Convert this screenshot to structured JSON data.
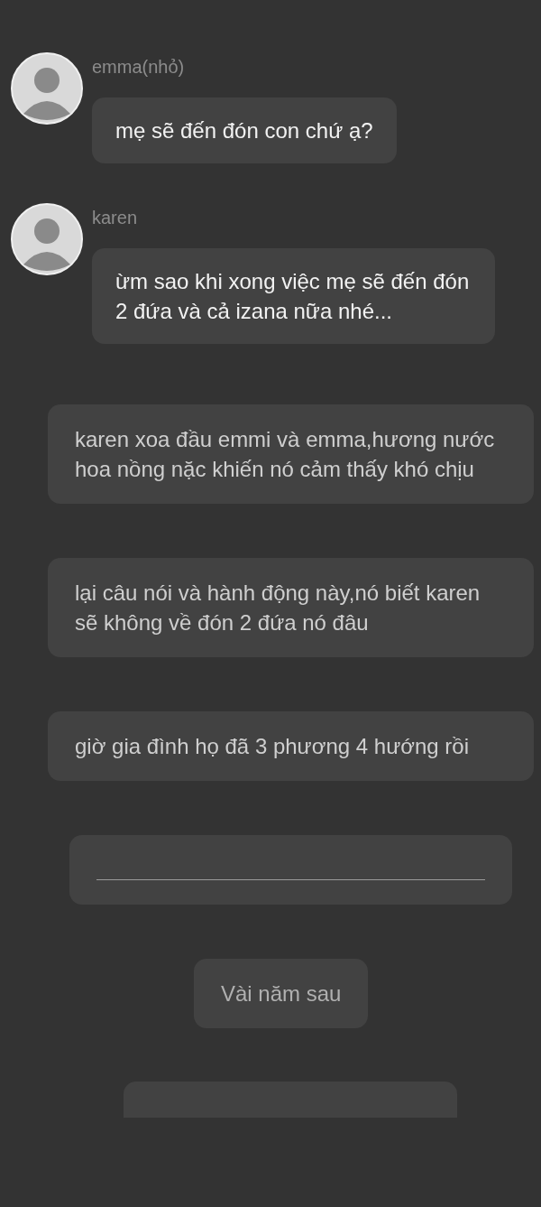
{
  "items": [
    {
      "kind": "message",
      "name": "emma(nhỏ)",
      "text": "mẹ sẽ đến đón con chứ ạ?"
    },
    {
      "kind": "message",
      "name": "karen",
      "text": "ừm sao khi xong việc mẹ sẽ đến đón 2 đứa và cả izana nữa nhé..."
    },
    {
      "kind": "narration",
      "text": "karen xoa đầu emmi và emma,hương nước hoa nồng nặc khiến nó cảm thấy khó chịu"
    },
    {
      "kind": "narration",
      "text": "lại câu nói và hành động này,nó biết karen sẽ không về đón 2 đứa nó đâu"
    },
    {
      "kind": "narration",
      "text": "giờ gia đình họ đã 3 phương 4 hướng rồi"
    },
    {
      "kind": "divider"
    },
    {
      "kind": "caption",
      "text": "Vài năm sau"
    },
    {
      "kind": "partial"
    }
  ]
}
